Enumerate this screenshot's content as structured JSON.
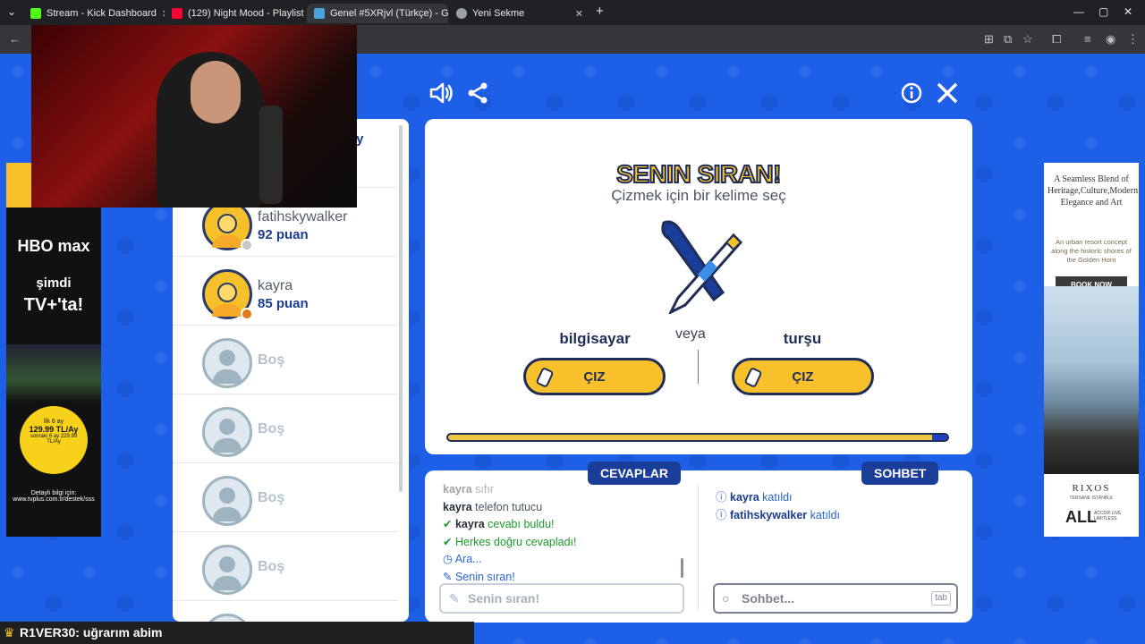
{
  "browser": {
    "tabs": [
      {
        "title": "Stream - Kick Dashboard",
        "color": "#53fc18"
      },
      {
        "title": "(129) Night Mood - Playlist",
        "color": "#ff0033"
      },
      {
        "title": "Genel #5XRjvl (Türkçe) - Ga",
        "color": "#4aa3df"
      },
      {
        "title": "Yeni Sekme",
        "color": "#9aa0a6"
      }
    ],
    "close_glyph": "✕",
    "new_tab_glyph": "+"
  },
  "game": {
    "title": "SENIN SIRAN!",
    "subtitle": "Çizmek için bir kelime seç",
    "or_label": "veya",
    "word1": "bilgisayar",
    "word2": "turşu",
    "draw_label": "ÇIZ",
    "progress": 0.97
  },
  "players": {
    "partial_name": "oy",
    "list": [
      {
        "name": "fatihskywalker",
        "score": "92 puan",
        "status_color": "#c7c7c7"
      },
      {
        "name": "kayra",
        "score": "85 puan",
        "status_color": "#e07a1c"
      }
    ],
    "empty_label": "Boş"
  },
  "answers": {
    "tab_label": "CEVAPLAR",
    "messages": [
      {
        "user": "kayra",
        "text": "sıfır"
      },
      {
        "user": "kayra",
        "text": "telefon tutucu"
      },
      {
        "icon": "✔",
        "user": "kayra",
        "text": "cevabı buldu!"
      },
      {
        "icon": "✔",
        "user": "",
        "text": "Herkes doğru cevapladı!"
      },
      {
        "icon": "◷",
        "user": "",
        "text": "Ara..."
      },
      {
        "icon": "✎",
        "user": "",
        "text": "Senin sıran!"
      }
    ],
    "input_placeholder": "Senin sıran!"
  },
  "chat": {
    "tab_label": "SOHBET",
    "messages": [
      {
        "user": "kayra",
        "text": "katıldı"
      },
      {
        "user": "fatihskywalker",
        "text": "katıldı"
      }
    ],
    "input_placeholder": "Sohbet...",
    "tab_hint": "tab"
  },
  "ad_left": {
    "brand": "HBO max",
    "line1": "şimdi",
    "line2": "TV+'ta!",
    "price_top": "İlk 6 ay",
    "price": "129.99 TL/Ay",
    "price_bottom": "sonraki 6 ay 229.99 TL/Ay",
    "footer": "Detaylı bilgi için: www.tvplus.com.tr/destek/sss"
  },
  "ad_right": {
    "headline": "A Seamless Blend of Heritage,Culture,Modern Elegance and Art",
    "subline": "An urban resort concept along the historic shores of the Golden Horn",
    "cta": "BOOK NOW",
    "brand": "RIXOS",
    "brand_sub": "TERSANE ISTANBUL",
    "partner": "ALL",
    "partner_sub": "ACCOR LIVE LIMITLESS"
  },
  "ticker": {
    "user": "R1VER30",
    "text": ": uğrarım abim"
  },
  "colors": {
    "background": "#1d5fe6",
    "accent_yellow": "#f8c12b",
    "navy": "#1f2d57"
  }
}
